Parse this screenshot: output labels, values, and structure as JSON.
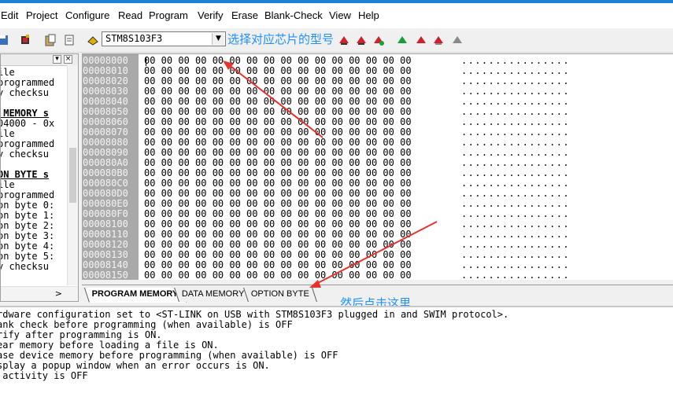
{
  "menu": [
    "Edit",
    "Project",
    "Configure",
    "Read",
    "Program",
    "Verify",
    "Erase",
    "Blank-Check",
    "View",
    "Help"
  ],
  "toolbar": {
    "device": "STM8S103F3",
    "icons": [
      "save-icon",
      "chip-icon",
      "paste-icon",
      "doc-icon",
      "device-icon",
      "read-icon",
      "read-current-icon",
      "program-icon",
      "program-current-icon",
      "verify-icon",
      "verify-current-icon",
      "blank-check-icon",
      "erase-icon",
      "program-all-icon",
      "program-next-icon",
      "program-auto-icon",
      "gear-icon"
    ],
    "colors": {
      "red": "#d0202a",
      "green": "#18a038",
      "gray": "#8a8a8a",
      "yellow": "#e0b000"
    }
  },
  "annotations": {
    "select_chip": "选择对应芯片的型号",
    "click_here": "然后点击这里"
  },
  "left_panel": {
    "lines": [
      {
        "text": "ile",
        "bold": false
      },
      {
        "text": "programmed",
        "bold": false
      },
      {
        "text": "y checksu",
        "bold": false
      },
      {
        "text": "",
        "bold": false
      },
      {
        "text": " MEMORY s",
        "bold": true
      },
      {
        "text": "04000 - 0x",
        "bold": false
      },
      {
        "text": "ile",
        "bold": false
      },
      {
        "text": "programmed",
        "bold": false
      },
      {
        "text": "y checksu",
        "bold": false
      },
      {
        "text": "",
        "bold": false
      },
      {
        "text": "ON BYTE s",
        "bold": true
      },
      {
        "text": "ile",
        "bold": false
      },
      {
        "text": "programmed",
        "bold": false
      },
      {
        "text": "on byte 0:",
        "bold": false
      },
      {
        "text": "on byte 1:",
        "bold": false
      },
      {
        "text": "on byte 2:",
        "bold": false
      },
      {
        "text": "on byte 3:",
        "bold": false
      },
      {
        "text": "on byte 4:",
        "bold": false
      },
      {
        "text": "on byte 5:",
        "bold": false
      },
      {
        "text": "y checksu",
        "bold": false
      }
    ]
  },
  "hex": {
    "rows": [
      {
        "addr": "00008000",
        "bytes": "00 00 00 00 00 00 00 00 00 00 00 00 00 00 00 00",
        "ascii": "................"
      },
      {
        "addr": "00008010",
        "bytes": "00 00 00 00 00 00 00 00 00 00 00 00 00 00 00 00",
        "ascii": "................"
      },
      {
        "addr": "00008020",
        "bytes": "00 00 00 00 00 00 00 00 00 00 00 00 00 00 00 00",
        "ascii": "................"
      },
      {
        "addr": "00008030",
        "bytes": "00 00 00 00 00 00 00 00 00 00 00 00 00 00 00 00",
        "ascii": "................"
      },
      {
        "addr": "00008040",
        "bytes": "00 00 00 00 00 00 00 00 00 00 00 00 00 00 00 00",
        "ascii": "................"
      },
      {
        "addr": "00008050",
        "bytes": "00 00 00 00 00 00 00 00 00 00 00 00 00 00 00 00",
        "ascii": "................"
      },
      {
        "addr": "00008060",
        "bytes": "00 00 00 00 00 00 00 00 00 00 00 00 00 00 00 00",
        "ascii": "................"
      },
      {
        "addr": "00008070",
        "bytes": "00 00 00 00 00 00 00 00 00 00 00 00 00 00 00 00",
        "ascii": "................"
      },
      {
        "addr": "00008080",
        "bytes": "00 00 00 00 00 00 00 00 00 00 00 00 00 00 00 00",
        "ascii": "................"
      },
      {
        "addr": "00008090",
        "bytes": "00 00 00 00 00 00 00 00 00 00 00 00 00 00 00 00",
        "ascii": "................"
      },
      {
        "addr": "000080A0",
        "bytes": "00 00 00 00 00 00 00 00 00 00 00 00 00 00 00 00",
        "ascii": "................"
      },
      {
        "addr": "000080B0",
        "bytes": "00 00 00 00 00 00 00 00 00 00 00 00 00 00 00 00",
        "ascii": "................"
      },
      {
        "addr": "000080C0",
        "bytes": "00 00 00 00 00 00 00 00 00 00 00 00 00 00 00 00",
        "ascii": "................"
      },
      {
        "addr": "000080D0",
        "bytes": "00 00 00 00 00 00 00 00 00 00 00 00 00 00 00 00",
        "ascii": "................"
      },
      {
        "addr": "000080E0",
        "bytes": "00 00 00 00 00 00 00 00 00 00 00 00 00 00 00 00",
        "ascii": "................"
      },
      {
        "addr": "000080F0",
        "bytes": "00 00 00 00 00 00 00 00 00 00 00 00 00 00 00 00",
        "ascii": "................"
      },
      {
        "addr": "00008100",
        "bytes": "00 00 00 00 00 00 00 00 00 00 00 00 00 00 00 00",
        "ascii": "................"
      },
      {
        "addr": "00008110",
        "bytes": "00 00 00 00 00 00 00 00 00 00 00 00 00 00 00 00",
        "ascii": "................"
      },
      {
        "addr": "00008120",
        "bytes": "00 00 00 00 00 00 00 00 00 00 00 00 00 00 00 00",
        "ascii": "................"
      },
      {
        "addr": "00008130",
        "bytes": "00 00 00 00 00 00 00 00 00 00 00 00 00 00 00 00",
        "ascii": "................"
      },
      {
        "addr": "00008140",
        "bytes": "00 00 00 00 00 00 00 00 00 00 00 00 00 00 00 00",
        "ascii": "................"
      },
      {
        "addr": "00008150",
        "bytes": "00 00 00 00 00 00 00 00 00 00 00 00 00 00 00 00",
        "ascii": "................"
      }
    ]
  },
  "tabs": [
    "PROGRAM MEMORY",
    "DATA MEMORY",
    "OPTION BYTE"
  ],
  "log": [
    "rdware configuration set to <ST-LINK on USB with STM8S103F3 plugged in and SWIM protocol>.",
    "ank check before programming (when available) is OFF",
    "rify after programming is ON.",
    "ear memory before loading a file is ON.",
    "ase device memory before programming (when available) is OFF",
    "splay a popup window when an error occurs is ON.",
    " activity is OFF"
  ]
}
